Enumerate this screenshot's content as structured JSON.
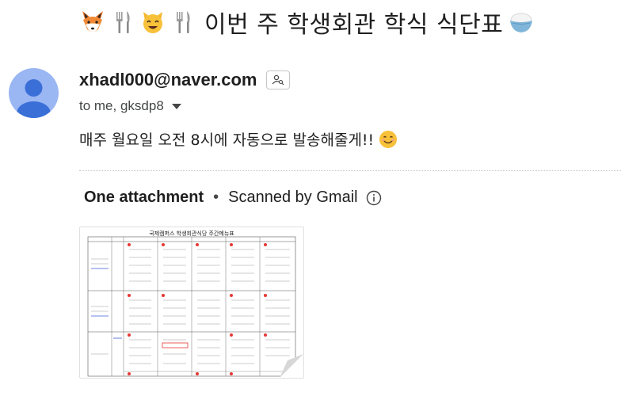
{
  "email": {
    "subject": "이번 주 학생회관 학식 식단표",
    "subject_emojis": [
      "fox-face",
      "fork-and-knife",
      "cat-face",
      "fork-and-knife",
      "rice-bowl"
    ],
    "sender": "xhadl000@naver.com",
    "recipients": "to me, gksdp8",
    "body": "매주 월요일 오전 8시에 자동으로 발송해줄게!!",
    "body_emoji": "smiling-face"
  },
  "attachments": {
    "title": "One attachment",
    "separator": "•",
    "scanned": "Scanned by Gmail",
    "thumbnail_title": "국제캠퍼스 학생회관식당 주간메뉴표"
  },
  "colors": {
    "avatar_bg": "#9ab6f3",
    "avatar_fg": "#3a6fd8",
    "text": "#1f1f1f",
    "muted": "#444746"
  }
}
